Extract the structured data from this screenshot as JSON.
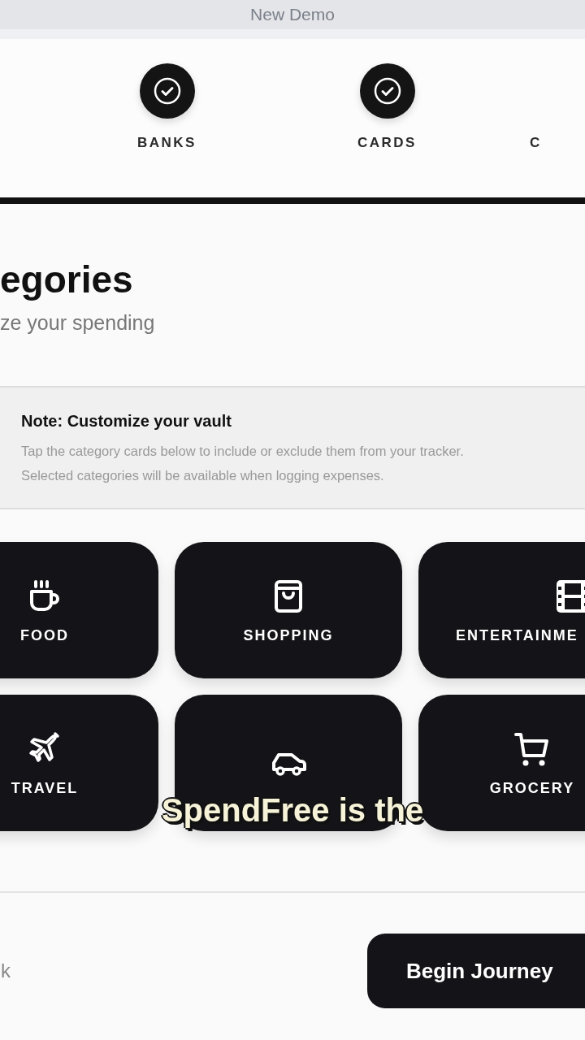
{
  "window": {
    "title": "New Demo"
  },
  "steps": [
    {
      "label": "BANKS",
      "done": true
    },
    {
      "label": "CARDS",
      "done": true
    },
    {
      "label": "C"
    }
  ],
  "heading": {
    "title": "egories",
    "subtitle": "ze your spending"
  },
  "note": {
    "title": "Note: Customize your vault",
    "lines": [
      "Tap the category cards below to include or exclude them from your tracker.",
      "Selected categories will be available when logging expenses."
    ]
  },
  "categories": [
    {
      "kind": "cup",
      "label": "FOOD"
    },
    {
      "kind": "bag",
      "label": "SHOPPING"
    },
    {
      "kind": "film",
      "label": "ENTERTAINME"
    },
    {
      "kind": "plane",
      "label": "TRAVEL"
    },
    {
      "kind": "car"
    },
    {
      "kind": "cart",
      "label": "GROCERY"
    }
  ],
  "footer": {
    "back": "k",
    "next": "Begin Journey"
  },
  "caption": "SpendFree is the"
}
